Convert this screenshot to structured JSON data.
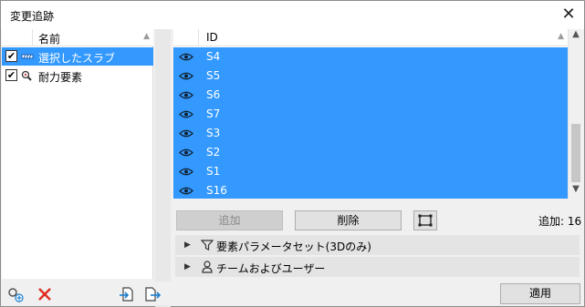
{
  "window": {
    "title": "変更追跡"
  },
  "left_panel": {
    "column_header": "名前",
    "items": [
      {
        "label": "選択したスラブ",
        "checked": true,
        "selected": true,
        "icon": "slab-icon"
      },
      {
        "label": "耐力要素",
        "checked": true,
        "selected": false,
        "icon": "magnifier-icon"
      }
    ],
    "footer_icons": [
      "add-track-icon",
      "delete-icon",
      "import-icon",
      "export-icon"
    ]
  },
  "right_panel": {
    "column_header": "ID",
    "rows": [
      "S4",
      "S5",
      "S6",
      "S7",
      "S3",
      "S2",
      "S1",
      "S16"
    ],
    "selection_color": "#3399ff"
  },
  "actions": {
    "add_label": "追加",
    "remove_label": "削除",
    "add_count_label": "追加: 16"
  },
  "expanders": [
    {
      "label": "要素パラメータセット(3Dのみ)",
      "icon": "filter-icon"
    },
    {
      "label": "チームおよびユーザー",
      "icon": "user-icon"
    }
  ],
  "apply_label": "適用"
}
